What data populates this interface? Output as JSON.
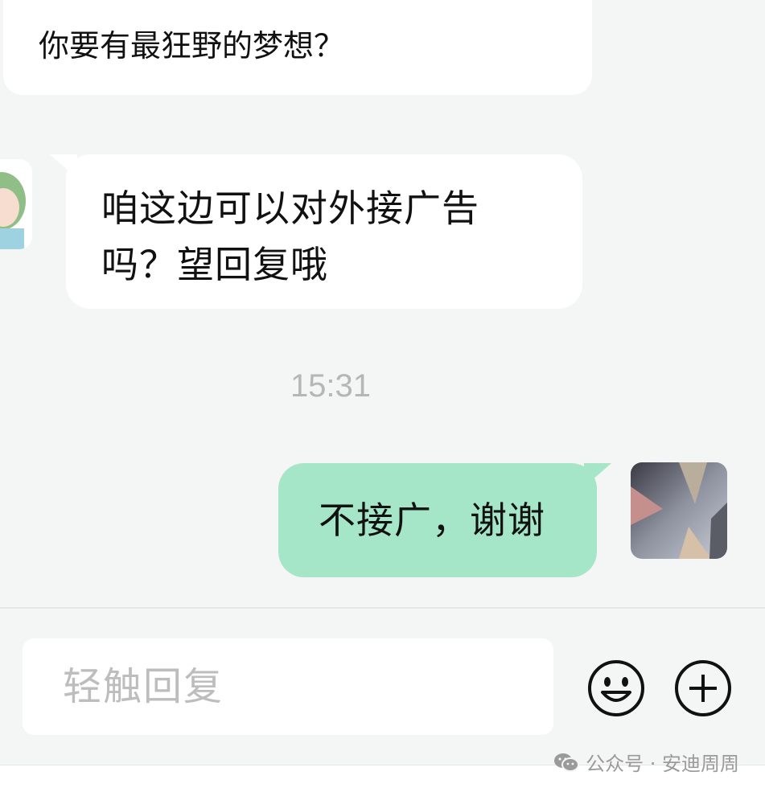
{
  "messages": [
    {
      "direction": "incoming",
      "text": "你要有最狂野的梦想？"
    },
    {
      "direction": "incoming",
      "text": "咱这边可以对外接广告吗？望回复哦"
    },
    {
      "direction": "outgoing",
      "text": "不接广，谢谢"
    }
  ],
  "timestamp": "15:31",
  "composer": {
    "placeholder": "轻触回复",
    "emoji_icon": "emoji-icon",
    "plus_icon": "plus-icon"
  },
  "watermark": {
    "text": "公众号 · 安迪周周",
    "icon": "wechat-icon"
  },
  "colors": {
    "background": "#f4f5f5",
    "incoming_bubble": "#ffffff",
    "outgoing_bubble": "#a6e6c8",
    "timestamp": "#b5b6b6",
    "placeholder": "#bdbdbd"
  }
}
